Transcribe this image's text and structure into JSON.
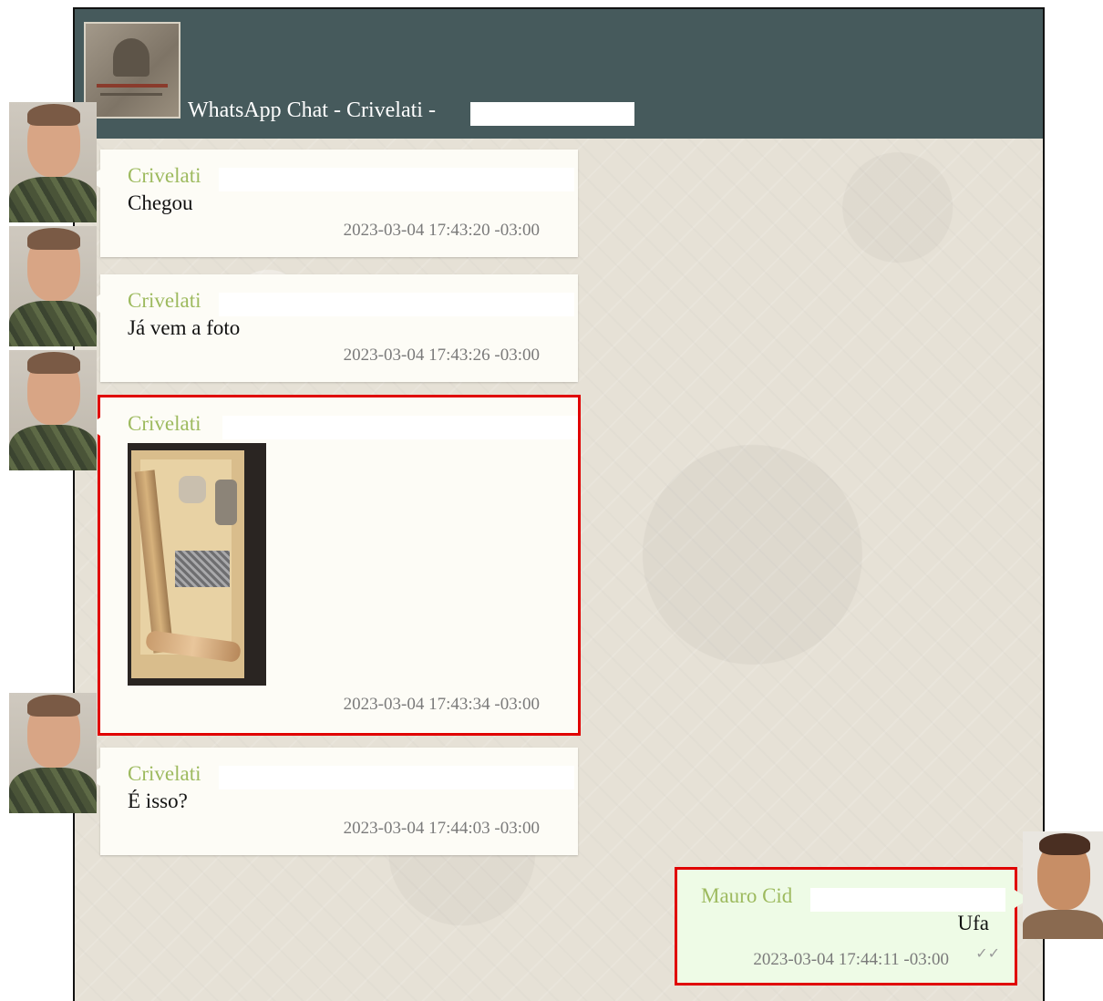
{
  "window": {
    "title": "WhatsApp Chat - Crivelati -"
  },
  "messages": [
    {
      "sender": "Crivelati",
      "text": "Chegou",
      "timestamp": "2023-03-04 17:43:20 -03:00"
    },
    {
      "sender": "Crivelati",
      "text": "Já vem a foto",
      "timestamp": "2023-03-04 17:43:26 -03:00"
    },
    {
      "sender": "Crivelati",
      "text": "",
      "timestamp": "2023-03-04 17:43:34 -03:00",
      "attachment": "photo"
    },
    {
      "sender": "Crivelati",
      "text": "É isso?",
      "timestamp": "2023-03-04 17:44:03 -03:00"
    },
    {
      "sender": "Mauro Cid",
      "text": "Ufa",
      "timestamp": "2023-03-04 17:44:11 -03:00",
      "status_icon": "double-check-icon"
    }
  ],
  "colors": {
    "header": "#465a5c",
    "sender_name": "#9dba5e",
    "incoming_bubble": "#fdfcf6",
    "outgoing_bubble": "#eefbe6",
    "highlight_box": "#e00000"
  }
}
